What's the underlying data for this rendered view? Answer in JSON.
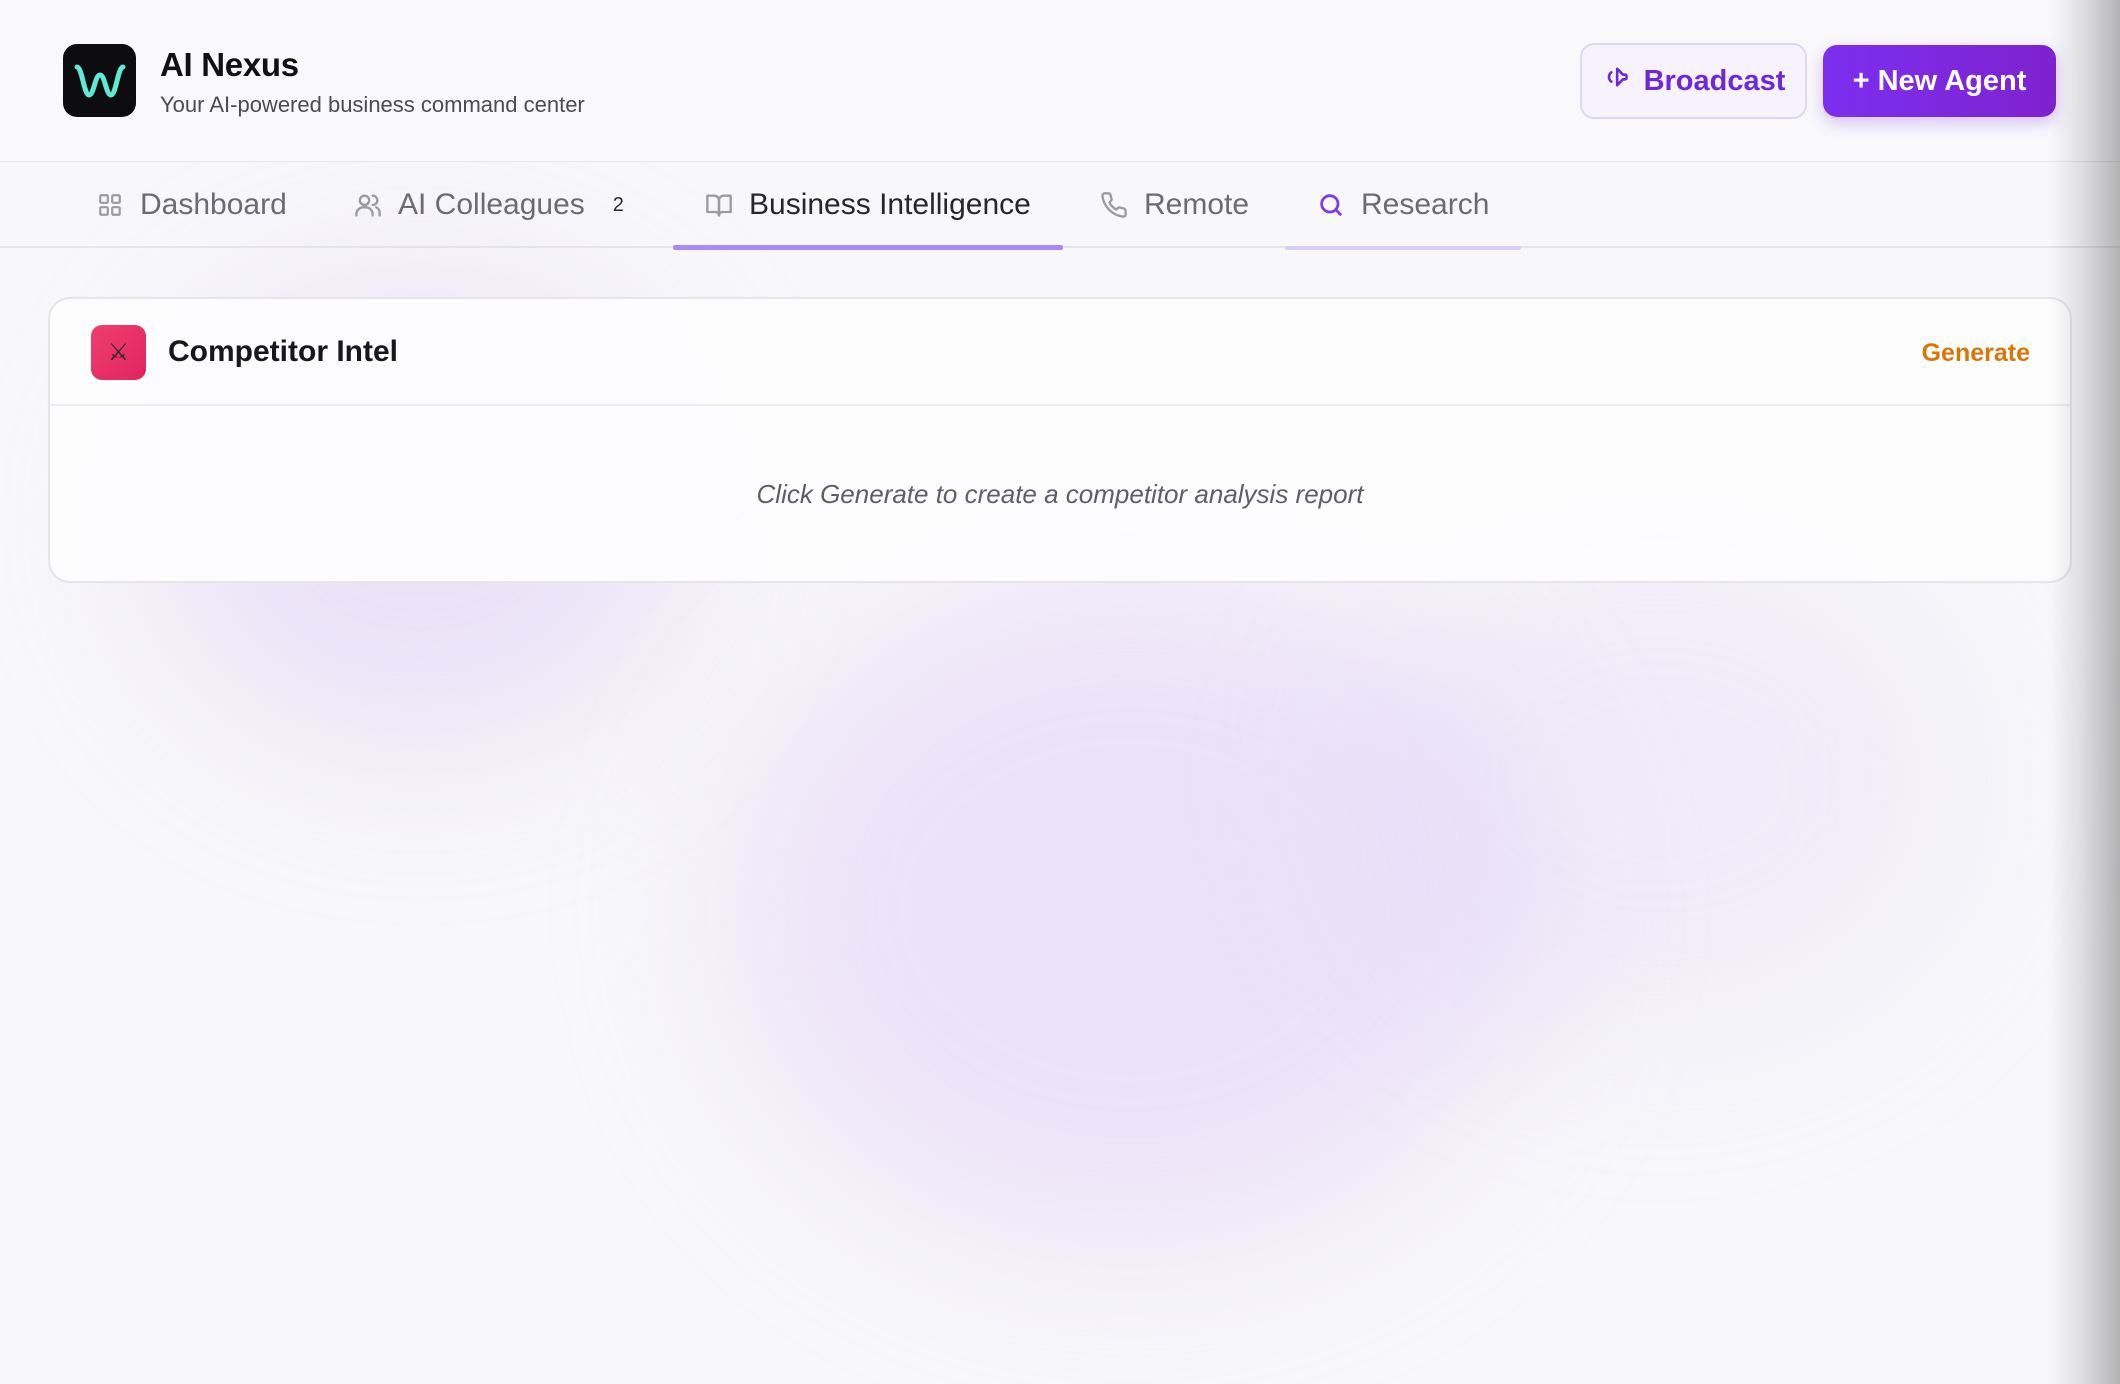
{
  "app": {
    "title": "AI Nexus",
    "subtitle": "Your AI-powered business command center",
    "logo_icon": "waveform-logo-icon"
  },
  "header": {
    "broadcast_label": "Broadcast",
    "broadcast_icon": "megaphone-icon",
    "new_agent_label": "+ New Agent"
  },
  "tabs": [
    {
      "label": "Dashboard",
      "icon": "grid-icon",
      "active": false
    },
    {
      "label": "AI Colleagues",
      "icon": "users-icon",
      "badge": "2",
      "active": false
    },
    {
      "label": "Business Intelligence",
      "icon": "book-icon",
      "active": true
    },
    {
      "label": "Remote",
      "icon": "phone-icon",
      "active": false
    },
    {
      "label": "Research",
      "icon": "search-icon",
      "active": false
    }
  ],
  "card": {
    "icon": "crossed-swords-icon",
    "icon_glyph": "⚔",
    "title": "Competitor Intel",
    "action_label": "Generate",
    "empty_message": "Click Generate to create a competitor analysis report"
  },
  "colors": {
    "accent": "#7c2ff0",
    "tab_indicator": "#a78bfa",
    "generate": "#d97706",
    "card_icon_bg": "#e8305f"
  }
}
